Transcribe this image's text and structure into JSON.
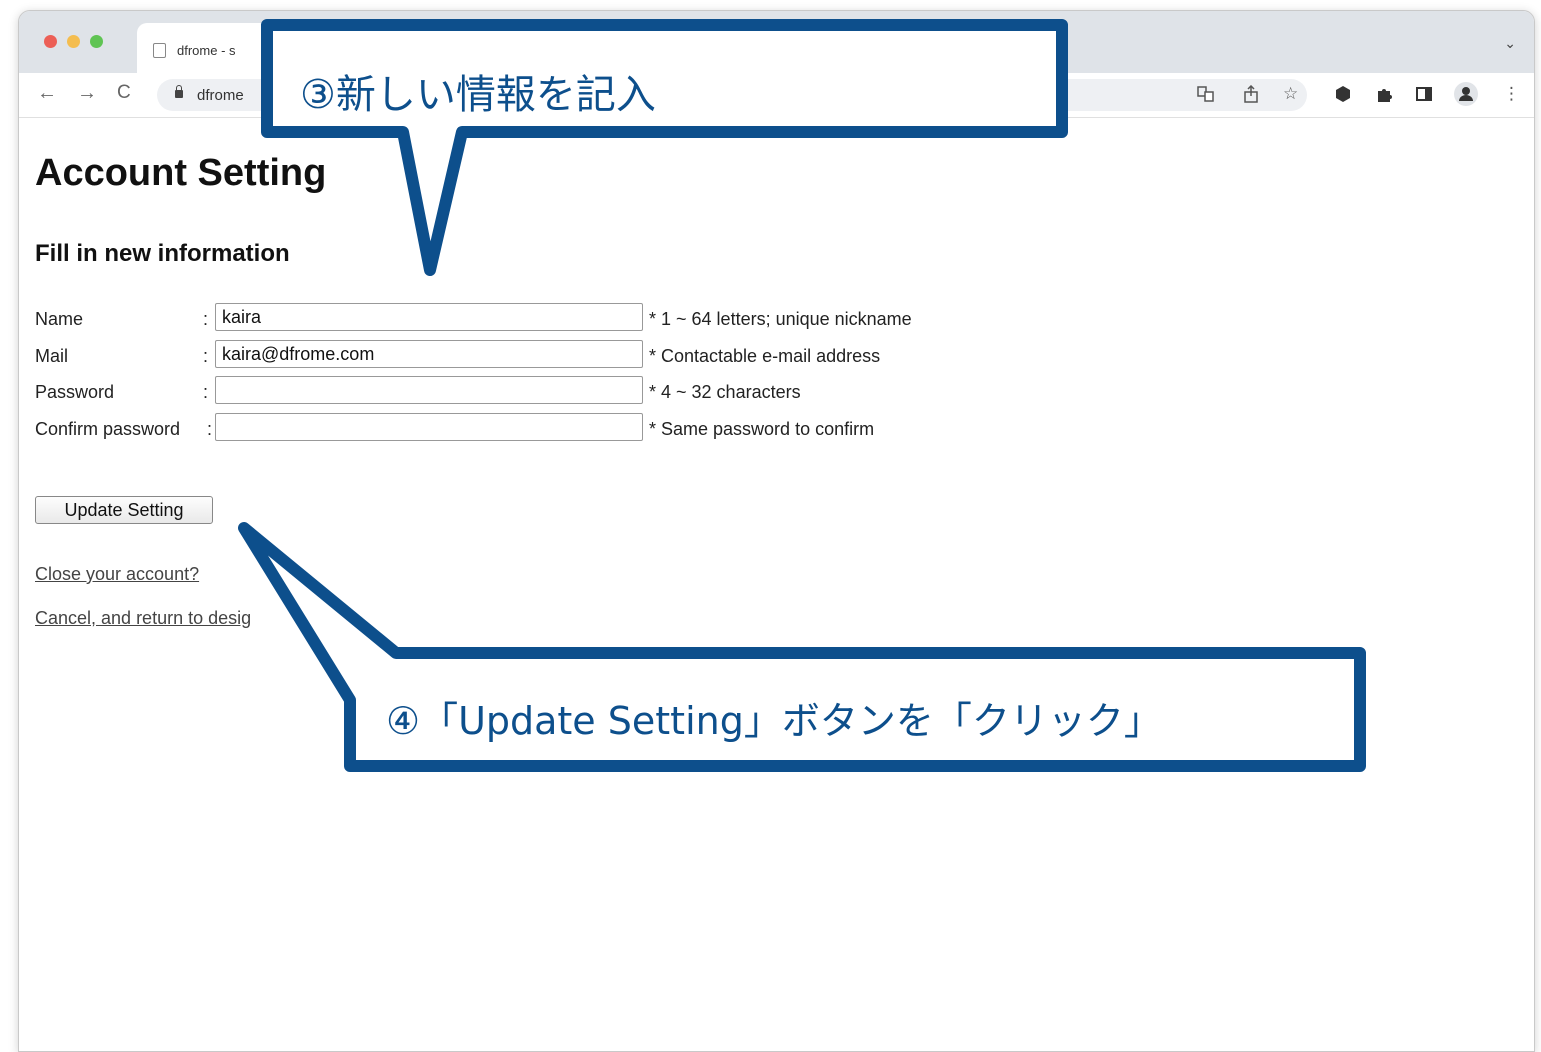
{
  "browser": {
    "tab_title": "dfrome - s",
    "tab_dropdown": "⌄",
    "url": "dfrome",
    "nav": {
      "back": "←",
      "forward": "→",
      "reload": "C"
    },
    "toolbar_icons": [
      "translate-icon",
      "share-icon",
      "bookmark-star-icon",
      "extension-hexagon-icon",
      "puzzle-icon",
      "side-panel-icon",
      "profile-icon",
      "menu-icon"
    ]
  },
  "page": {
    "title": "Account Setting",
    "subtitle": "Fill in new information",
    "form": {
      "rows": [
        {
          "label": "Name",
          "colon": ":",
          "value": "kaira",
          "hint": "* 1 ~ 64 letters; unique nickname"
        },
        {
          "label": "Mail",
          "colon": ":",
          "value": "kaira@dfrome.com",
          "hint": "* Contactable e-mail address"
        },
        {
          "label": "Password",
          "colon": ":",
          "value": "",
          "hint": "* 4 ~ 32 characters"
        },
        {
          "label": "Confirm password",
          "colon": ":",
          "value": "",
          "hint": "* Same password to confirm"
        }
      ]
    },
    "update_button": "Update Setting",
    "links": {
      "close_account": "Close your account?",
      "cancel": "Cancel, and return to desig"
    }
  },
  "callouts": {
    "step3": "③新しい情報を記入",
    "step4": "④「Update Setting」ボタンを「クリック」",
    "color": "#0d4f8c"
  }
}
